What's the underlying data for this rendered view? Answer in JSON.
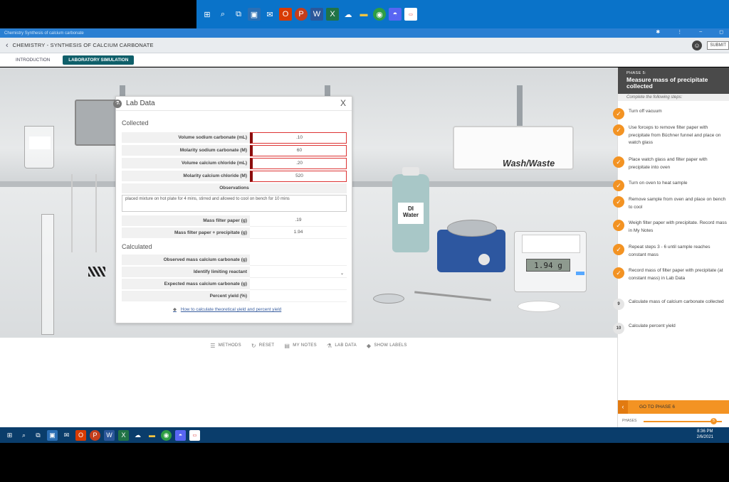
{
  "app": {
    "window_title": "Chemistry Synthesis of calcium carbonate",
    "header_title": "CHEMISTRY - SYNTHESIS OF CALCIUM CARBONATE",
    "submit_label": "SUBMIT",
    "tabs": [
      {
        "label": "INTRODUCTION"
      },
      {
        "label": "LABORATORY SIMULATION"
      }
    ]
  },
  "scene": {
    "sink_label": "Wash/Waste",
    "bottle_label_1": "DI",
    "bottle_label_2": "Water",
    "balance_display": "1.94 g"
  },
  "lab_data": {
    "title": "Lab Data",
    "close": "X",
    "collected_heading": "Collected",
    "collected_rows": [
      {
        "label": "Volume sodium carbonate (mL)",
        "value": ".10"
      },
      {
        "label": "Molarity sodium carbonate (M)",
        "value": "60"
      },
      {
        "label": "Volume calcium chloride (mL)",
        "value": ".20"
      },
      {
        "label": "Molarity calcium chloride (M)",
        "value": "520"
      }
    ],
    "observations_heading": "Observations",
    "observations_text": "placed mixture on hot plate for 4 mins, stirred and allowed to cool on bench for 10 mins",
    "mass_rows": [
      {
        "label": "Mass filter paper (g)",
        "value": ".19"
      },
      {
        "label": "Mass filter paper + precipitate (g)",
        "value": "1.94"
      }
    ],
    "calculated_heading": "Calculated",
    "calculated_rows": [
      {
        "label": "Observed mass calcium carbonate (g)",
        "value": ""
      },
      {
        "label": "Identify limiting reactant",
        "value": ""
      },
      {
        "label": "Expected mass calcium carbonate (g)",
        "value": ""
      },
      {
        "label": "Percent yield (%)",
        "value": ""
      }
    ],
    "help_link": "How to calculate theoretical yield and percent yield"
  },
  "toolbar": [
    {
      "label": "METHODS",
      "icon": "list-icon"
    },
    {
      "label": "RESET",
      "icon": "reset-icon"
    },
    {
      "label": "MY NOTES",
      "icon": "notes-icon"
    },
    {
      "label": "LAB DATA",
      "icon": "flask-icon"
    },
    {
      "label": "SHOW LABELS",
      "icon": "tag-icon"
    }
  ],
  "sidebar": {
    "phase_label": "PHASE 5:",
    "phase_name": "Measure mass of precipitate collected",
    "complete_text": "Complete the following steps:",
    "steps": [
      {
        "num": "✓",
        "text": "Turn off vacuum",
        "done": true
      },
      {
        "num": "✓",
        "text": "Use forceps to remove filter paper with precipitate from Büchner funnel and place on watch glass",
        "done": true
      },
      {
        "num": "✓",
        "text": "Place watch glass and filter paper with precipitate into oven",
        "done": true
      },
      {
        "num": "✓",
        "text": "Turn on oven to heat sample",
        "done": true
      },
      {
        "num": "✓",
        "text": "Remove sample from oven and place on bench to cool",
        "done": true
      },
      {
        "num": "✓",
        "text": "Weigh filter paper with precipitate. Record mass in My Notes",
        "done": true
      },
      {
        "num": "✓",
        "text": "Repeat steps 3 - 6 until sample reaches constant mass",
        "done": true
      },
      {
        "num": "✓",
        "text": "Record mass of filter paper with precipitate (at constant mass) in Lab Data",
        "done": true
      },
      {
        "num": "9",
        "text": "Calculate mass of calcium carbonate collected",
        "done": false
      },
      {
        "num": "10",
        "text": "Calculate percent yield",
        "done": false
      }
    ],
    "goto_label": "GO TO PHASE 6",
    "phases_label": "PHASES",
    "phase_dot": "5"
  },
  "clock": {
    "time": "8:36 PM",
    "date": "2/6/2021"
  }
}
